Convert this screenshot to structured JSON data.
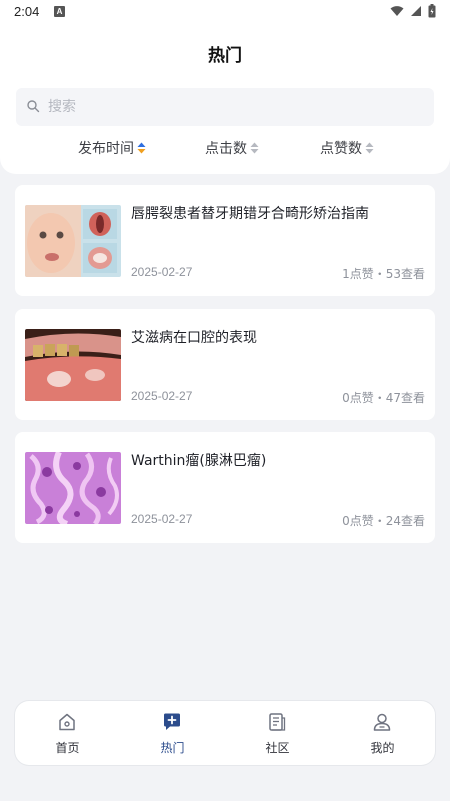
{
  "status_bar": {
    "time": "2:04",
    "notif_glyph": "A"
  },
  "header": {
    "title": "热门",
    "search_placeholder": "搜索",
    "sort": [
      {
        "label": "发布时间",
        "active": true
      },
      {
        "label": "点击数",
        "active": false
      },
      {
        "label": "点赞数",
        "active": false
      }
    ]
  },
  "articles": [
    {
      "title": "唇腭裂患者替牙期错牙合畸形矫治指南",
      "date": "2025-02-27",
      "stats": "1点赞・53查看",
      "thumb_icon": "cleft-lip-photo"
    },
    {
      "title": "艾滋病在口腔的表现",
      "date": "2025-02-27",
      "stats": "0点赞・47查看",
      "thumb_icon": "oral-lesion-photo"
    },
    {
      "title": "Warthin瘤(腺淋巴瘤)",
      "date": "2025-02-27",
      "stats": "0点赞・24查看",
      "thumb_icon": "histology-photo"
    }
  ],
  "tab_bar": {
    "tabs": [
      {
        "label": "首页",
        "icon": "home-icon",
        "active": false
      },
      {
        "label": "热门",
        "icon": "hot-icon",
        "active": true
      },
      {
        "label": "社区",
        "icon": "community-icon",
        "active": false
      },
      {
        "label": "我的",
        "icon": "profile-icon",
        "active": false
      }
    ]
  },
  "colors": {
    "accent": "#2c4c8c",
    "sort_active_up": "#2f6fe0",
    "sort_active_down": "#f0a020",
    "background": "#f2f3f6"
  }
}
